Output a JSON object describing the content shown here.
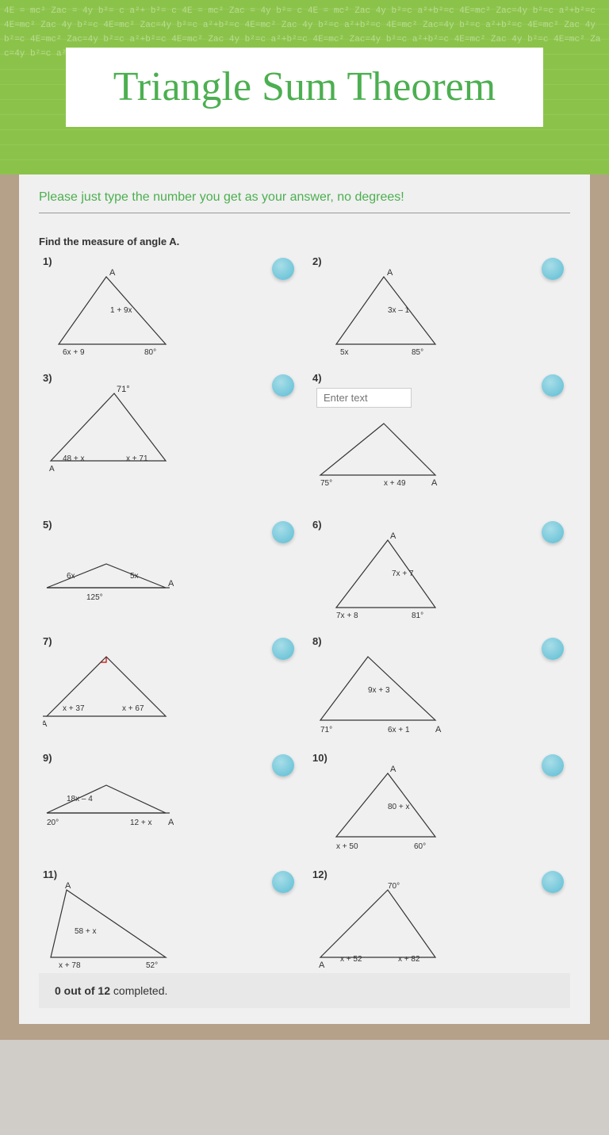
{
  "header": {
    "title": "Triangle Sum Theorem",
    "bg_color": "#8bc34a"
  },
  "instructions": "Please just type the number you get as your answer, no degrees!",
  "find_label": "Find the measure of angle A.",
  "problems": [
    {
      "number": "1)",
      "type": "triangle",
      "angles": [
        "1 + 9x",
        "6x + 9",
        "80°"
      ],
      "vertex_label": "A",
      "answer_placeholder": ""
    },
    {
      "number": "2)",
      "type": "triangle",
      "angles": [
        "3x – 1",
        "5x",
        "85°"
      ],
      "vertex_label": "A",
      "answer_placeholder": ""
    },
    {
      "number": "3)",
      "type": "triangle",
      "angles": [
        "71°",
        "48 + x",
        "x + 71"
      ],
      "vertex_label": "A",
      "answer_placeholder": ""
    },
    {
      "number": "4)",
      "type": "triangle",
      "angles": [
        "75°",
        "x + 49",
        ""
      ],
      "vertex_label": "A",
      "answer_placeholder": "Enter text"
    },
    {
      "number": "5)",
      "type": "flat_triangle",
      "angles": [
        "6x",
        "5x",
        "125°"
      ],
      "vertex_label": "A",
      "answer_placeholder": ""
    },
    {
      "number": "6)",
      "type": "triangle",
      "angles": [
        "7x + 7",
        "7x + 8",
        "81°"
      ],
      "vertex_label": "A",
      "answer_placeholder": ""
    },
    {
      "number": "7)",
      "type": "triangle",
      "angles": [
        "x + 37",
        "x + 67",
        ""
      ],
      "vertex_label": "A",
      "answer_placeholder": ""
    },
    {
      "number": "8)",
      "type": "triangle",
      "angles": [
        "9x + 3",
        "71°",
        "6x + 1"
      ],
      "vertex_label": "A",
      "answer_placeholder": ""
    },
    {
      "number": "9)",
      "type": "flat_triangle",
      "angles": [
        "18x – 4",
        "20°",
        "12 + x"
      ],
      "vertex_label": "A",
      "answer_placeholder": ""
    },
    {
      "number": "10)",
      "type": "triangle",
      "angles": [
        "80 + x",
        "x + 50",
        "60°"
      ],
      "vertex_label": "A",
      "answer_placeholder": ""
    },
    {
      "number": "11)",
      "type": "triangle",
      "angles": [
        "58 + x",
        "x + 78",
        "52°"
      ],
      "vertex_label": "A",
      "answer_placeholder": ""
    },
    {
      "number": "12)",
      "type": "triangle",
      "angles": [
        "70°",
        "x + 52",
        "x + 82"
      ],
      "vertex_label": "A",
      "answer_placeholder": ""
    }
  ],
  "progress": {
    "completed": 0,
    "total": 12,
    "label": "0 out of 12 completed."
  }
}
